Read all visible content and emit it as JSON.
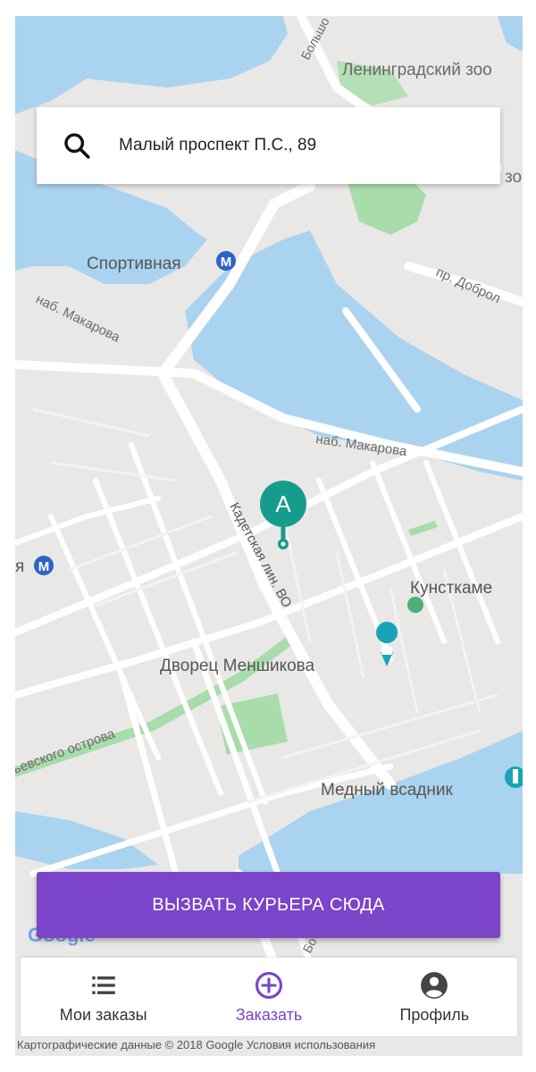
{
  "search": {
    "value": "Малый проспект П.С., 89"
  },
  "map": {
    "labels": {
      "bolshoi": "Большо",
      "zoo": "Ленинградский зоо",
      "zo2": "зо",
      "dobrol": "пр. Доброл",
      "sportivnaya": "Спортивная",
      "nab_makarova_1": "наб. Макарова",
      "nab_makarova_2": "наб. Макарова",
      "kadetskaya": "Кадетская лин. ВО",
      "kunstkamera": "Кунсткаме",
      "menshikov": "Дворец Меншикова",
      "ostrova": "ьевского острова",
      "medny": "Медный всадник",
      "bolshoi_bottom": "Бо",
      "metro_left": "я"
    },
    "pin_letter": "A",
    "google_logo": "Google",
    "colors": {
      "water": "#aad3f0",
      "land": "#e9e8e6",
      "road": "#ffffff",
      "park": "#a8dcaa",
      "pin": "#169c8c"
    }
  },
  "call_button": {
    "label": "ВЫЗВАТЬ КУРЬЕРА СЮДА",
    "color": "#7b44c9"
  },
  "nav": {
    "orders": "Мои заказы",
    "order": "Заказать",
    "profile": "Профиль",
    "active_color": "#7b44c9"
  },
  "attribution": "Картографические данные © 2018 Google   Условия использования"
}
